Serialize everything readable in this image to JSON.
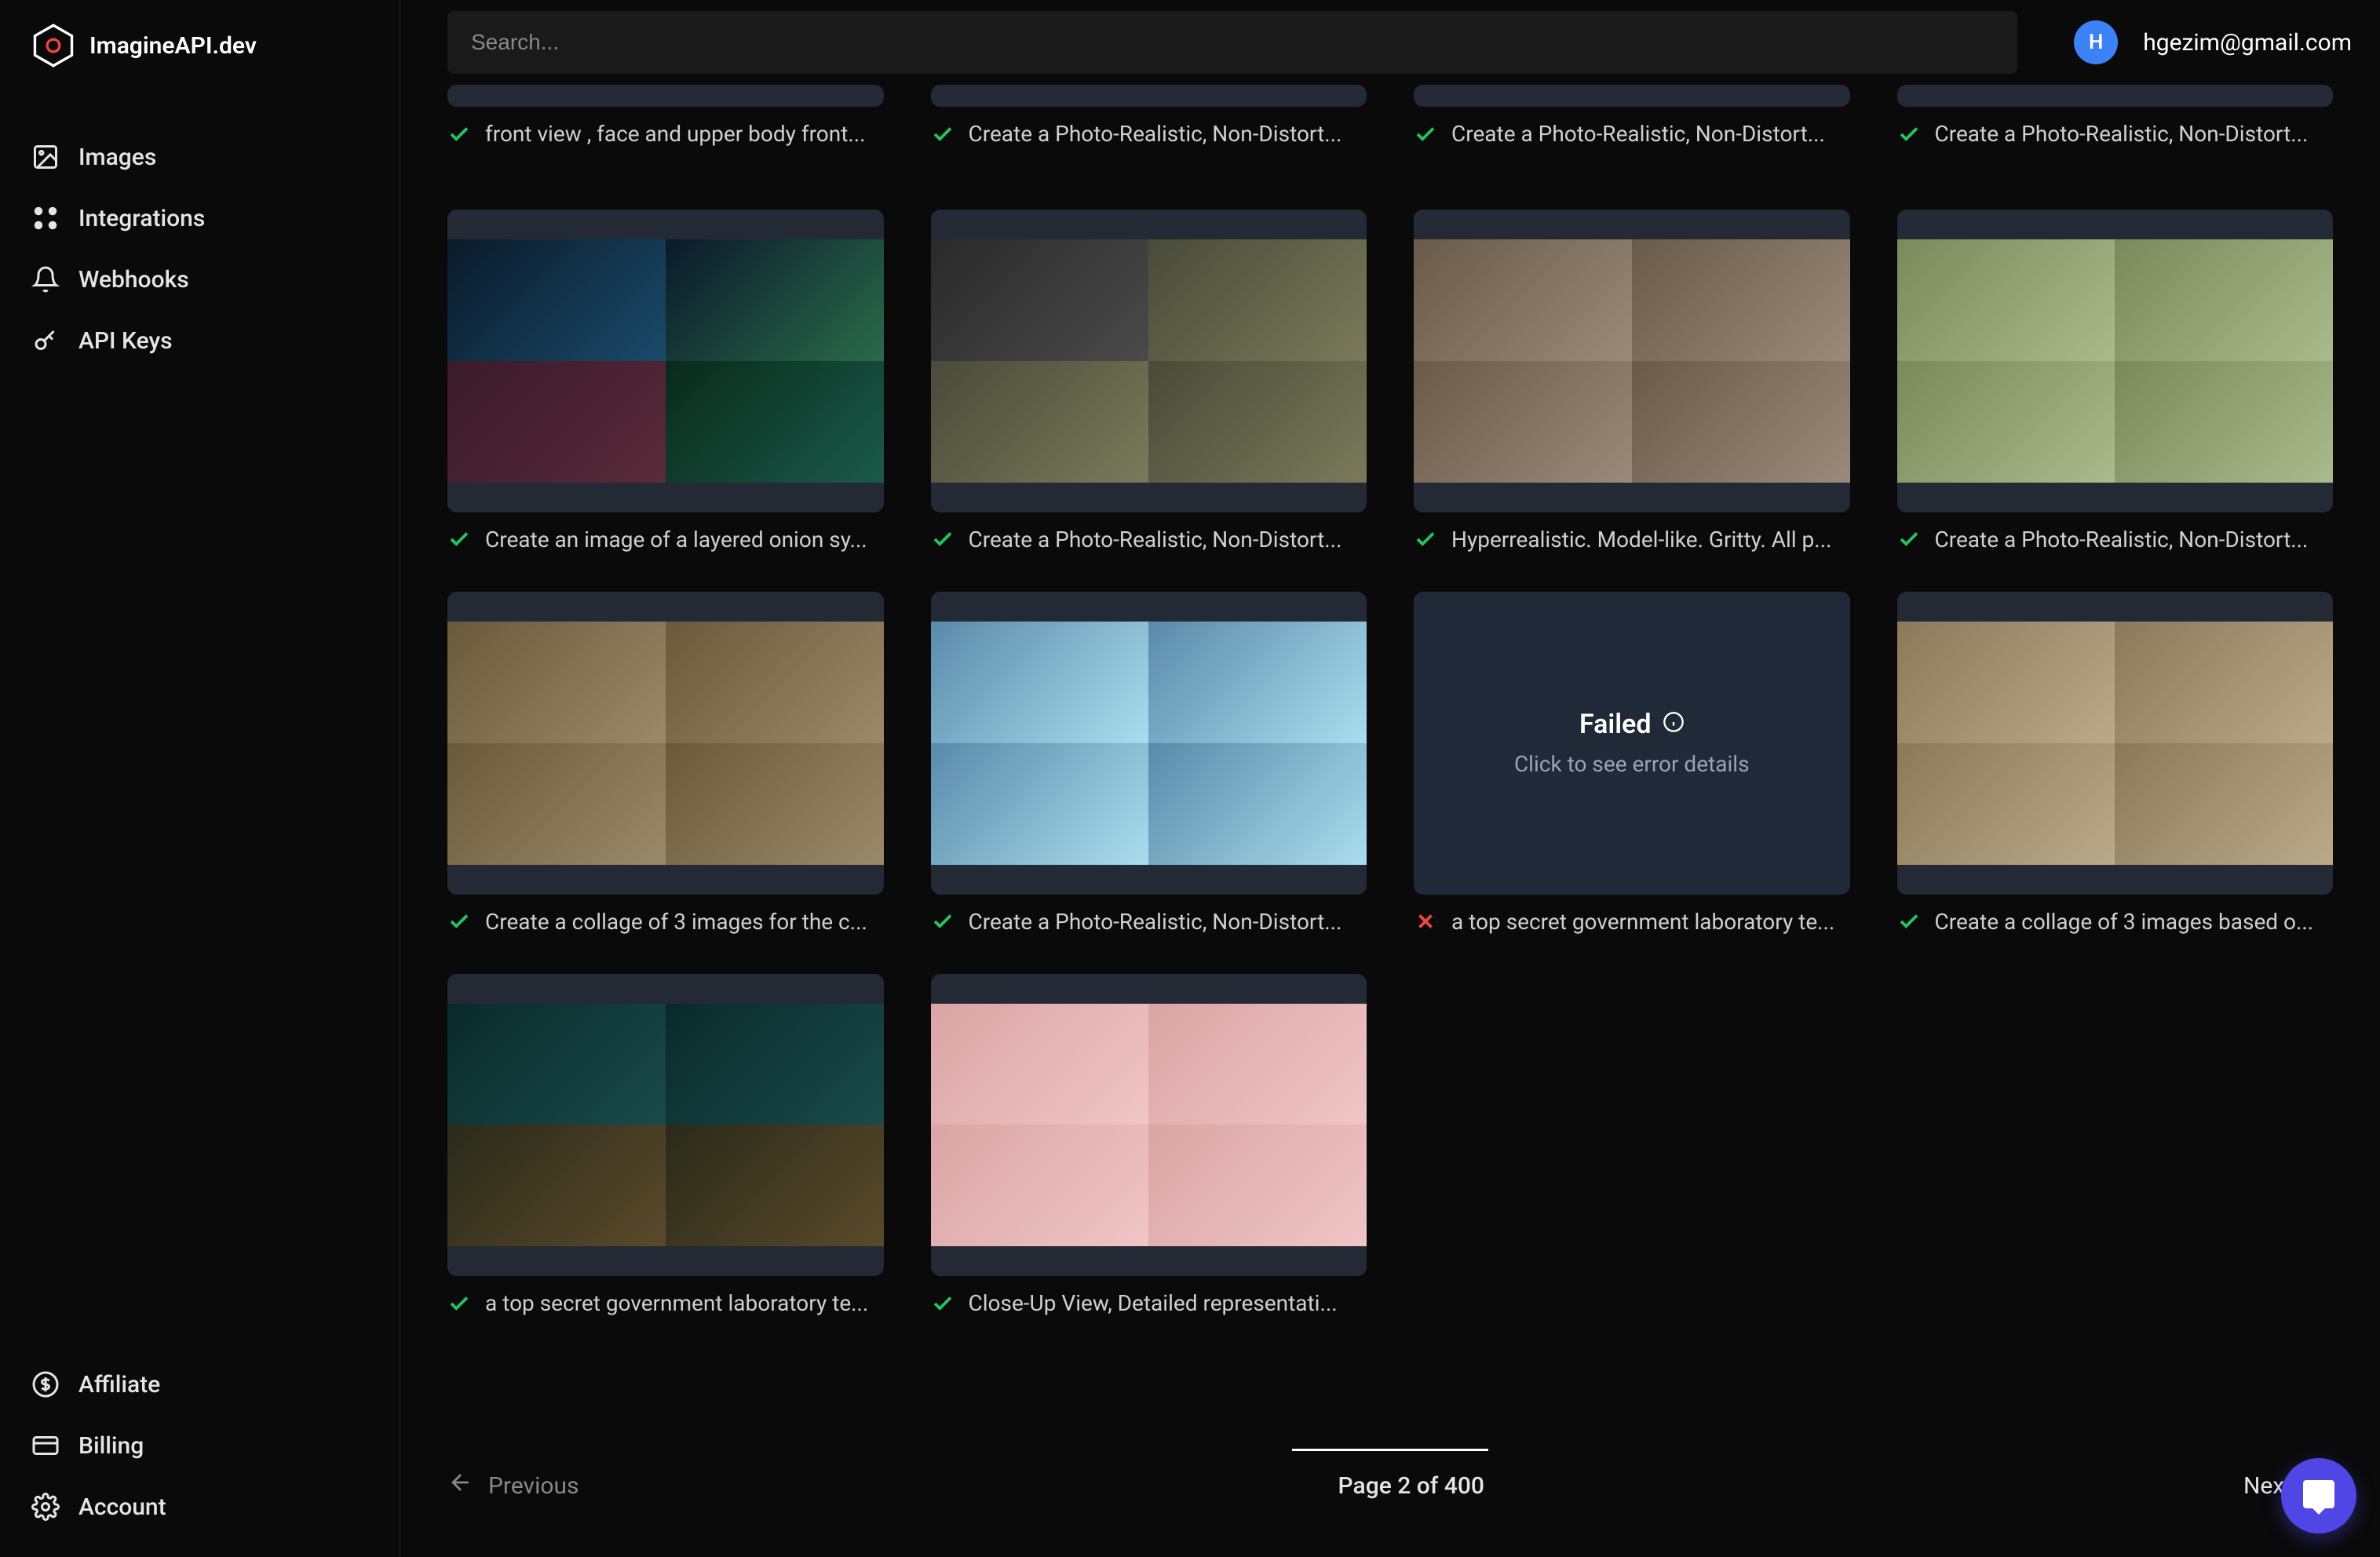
{
  "brand": "ImagineAPI.dev",
  "search": {
    "placeholder": "Search..."
  },
  "user": {
    "initial": "H",
    "email": "hgezim@gmail.com"
  },
  "nav": {
    "top": [
      {
        "id": "images",
        "label": "Images"
      },
      {
        "id": "integrations",
        "label": "Integrations"
      },
      {
        "id": "webhooks",
        "label": "Webhooks"
      },
      {
        "id": "apikeys",
        "label": "API Keys"
      }
    ],
    "bottom": [
      {
        "id": "affiliate",
        "label": "Affiliate"
      },
      {
        "id": "billing",
        "label": "Billing"
      },
      {
        "id": "account",
        "label": "Account"
      }
    ]
  },
  "failed": {
    "title": "Failed",
    "subtitle": "Click to see error details"
  },
  "partial_row": [
    {
      "status": "ok",
      "caption": "front view , face and upper body front..."
    },
    {
      "status": "ok",
      "caption": "Create a Photo-Realistic, Non-Distort..."
    },
    {
      "status": "ok",
      "caption": "Create a Photo-Realistic, Non-Distort..."
    },
    {
      "status": "ok",
      "caption": "Create a Photo-Realistic, Non-Distort..."
    }
  ],
  "rows": [
    [
      {
        "status": "ok",
        "theme": "t-blue",
        "caption": "Create an image of a layered onion sy..."
      },
      {
        "status": "ok",
        "theme": "t-car",
        "caption": "Create a Photo-Realistic, Non-Distort..."
      },
      {
        "status": "ok",
        "theme": "t-hand",
        "caption": "Hyperrealistic. Model-like. Gritty. All p..."
      },
      {
        "status": "ok",
        "theme": "t-suv",
        "caption": "Create a Photo-Realistic, Non-Distort..."
      }
    ],
    [
      {
        "status": "ok",
        "theme": "t-wood",
        "caption": "Create a collage of 3 images for the c..."
      },
      {
        "status": "ok",
        "theme": "t-ship",
        "caption": "Create a Photo-Realistic, Non-Distort..."
      },
      {
        "status": "fail",
        "theme": "",
        "caption": "a top secret government laboratory te..."
      },
      {
        "status": "ok",
        "theme": "t-truck",
        "caption": "Create a collage of 3 images based o..."
      }
    ],
    [
      {
        "status": "ok",
        "theme": "t-lab",
        "caption": "a top secret government laboratory te..."
      },
      {
        "status": "ok",
        "theme": "t-pink",
        "caption": "Close-Up View, Detailed representati..."
      }
    ]
  ],
  "pager": {
    "prev": "Previous",
    "next": "Next",
    "label": "Page 2 of 400"
  }
}
